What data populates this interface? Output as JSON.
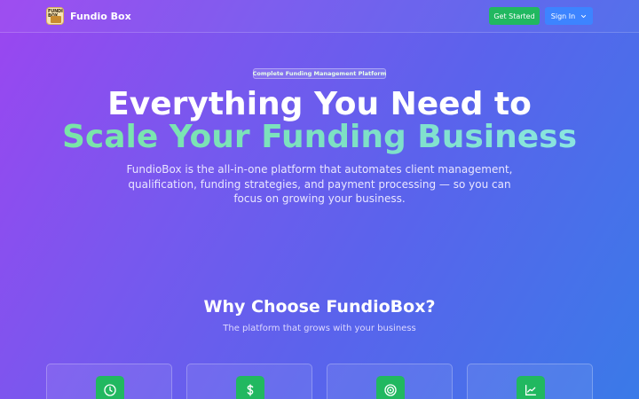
{
  "nav": {
    "logo_text": "FUNDIO BOX",
    "brand": "Fundio Box",
    "get_started": "Get Started",
    "sign_in": "Sign In"
  },
  "hero": {
    "badge": "Complete Funding Management Platform",
    "title_line1": "Everything You Need to",
    "title_line2": "Scale Your Funding Business",
    "subtitle": "FundioBox is the all-in-one platform that automates client management, qualification, funding strategies, and payment processing — so you can focus on growing your business."
  },
  "why": {
    "title": "Why Choose FundioBox?",
    "tagline": "The platform that grows with your business"
  },
  "features": [
    {
      "icon": "clock-icon"
    },
    {
      "icon": "dollar-icon"
    },
    {
      "icon": "target-icon"
    },
    {
      "icon": "chart-line-icon"
    }
  ],
  "colors": {
    "accent_green": "#21b860",
    "accent_blue": "#3d84ff",
    "headline_gradient": "#78e6a0"
  }
}
